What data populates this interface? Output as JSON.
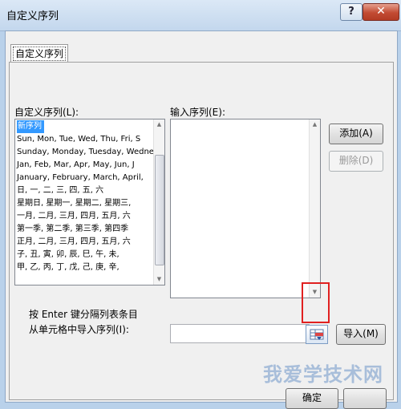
{
  "window": {
    "title": "自定义序列",
    "help_label": "?",
    "close_label": "✕"
  },
  "tab": {
    "label": "自定义序列"
  },
  "custom_list": {
    "label": "自定义序列(L):",
    "items": [
      "新序列",
      "Sun, Mon, Tue, Wed, Thu, Fri, S",
      "Sunday, Monday, Tuesday, Wednes",
      "Jan, Feb, Mar, Apr, May, Jun, J",
      "January, February, March, April,",
      "日, 一, 二, 三, 四, 五, 六",
      "星期日, 星期一, 星期二, 星期三,",
      "一月, 二月, 三月, 四月, 五月, 六",
      "第一季, 第二季, 第三季, 第四季",
      "正月, 二月, 三月, 四月, 五月, 六",
      "子, 丑, 寅, 卯, 辰, 巳, 午, 未,",
      "甲, 乙, 丙, 丁, 戊, 己, 庚, 辛,"
    ]
  },
  "entries": {
    "label": "输入序列(E):",
    "value": ""
  },
  "buttons": {
    "add": "添加(A)",
    "delete": "删除(D)",
    "import": "导入(M)",
    "ok": "确定"
  },
  "hint": {
    "line1": "按 Enter 键分隔列表条目",
    "line2": "从单元格中导入序列(I):"
  },
  "import_range": {
    "value": ""
  },
  "watermark": "我爱学技术网"
}
